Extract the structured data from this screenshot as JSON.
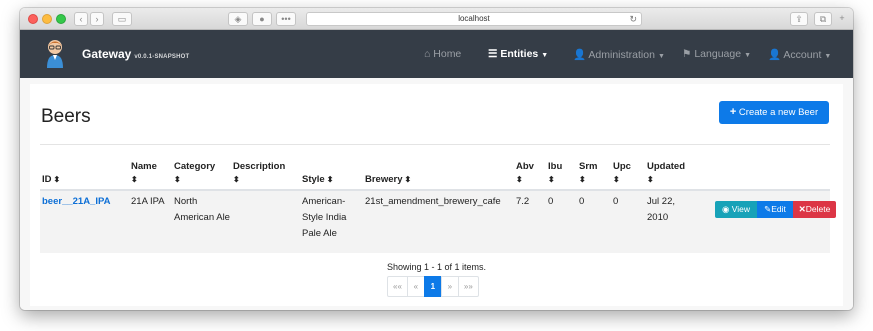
{
  "browser": {
    "url": "localhost",
    "accent": "#34c84a"
  },
  "navbar": {
    "brand": "Gateway",
    "version": "v0.0.1-SNAPSHOT",
    "items": [
      {
        "label": "Home",
        "icon": "home-icon",
        "glyph": "⌂"
      },
      {
        "label": "Entities",
        "icon": "list-icon",
        "glyph": "☰"
      },
      {
        "label": "Administration",
        "icon": "user-plus-icon",
        "glyph": "👤"
      },
      {
        "label": "Language",
        "icon": "flag-icon",
        "glyph": "⚑"
      },
      {
        "label": "Account",
        "icon": "user-icon",
        "glyph": "👤"
      }
    ]
  },
  "page": {
    "title": "Beers",
    "create_label": "Create a new Beer",
    "create_glyph": "+"
  },
  "table": {
    "columns": [
      "ID",
      "Name",
      "Category",
      "Description",
      "Style",
      "Brewery",
      "Abv",
      "Ibu",
      "Srm",
      "Upc",
      "Updated"
    ],
    "rows": [
      {
        "id": "beer__21A_IPA",
        "name": "21A IPA",
        "category": "North American Ale",
        "description": "",
        "style": "American-Style India Pale Ale",
        "brewery": "21st_amendment_brewery_cafe",
        "abv": "7.2",
        "ibu": "0",
        "srm": "0",
        "upc": "0",
        "updated": "Jul 22, 2010"
      }
    ],
    "actions": {
      "view": "View",
      "edit": "Edit",
      "delete": "Delete"
    }
  },
  "pagination": {
    "summary": "Showing 1 - 1 of 1 items.",
    "first": "««",
    "prev": "«",
    "current": "1",
    "next": "»",
    "last": "»»"
  },
  "colors": {
    "navbar": "#353d47",
    "primary": "#0d7ae8",
    "info": "#17a2b8",
    "danger": "#dc3545"
  },
  "sort_glyph": "⬍"
}
